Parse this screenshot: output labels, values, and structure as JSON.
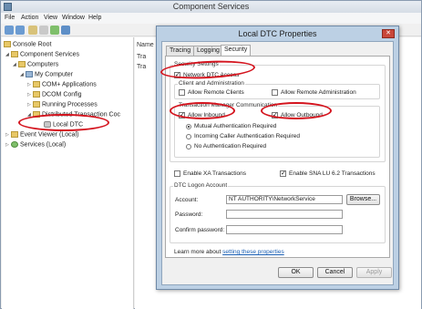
{
  "window": {
    "title": "Component Services"
  },
  "menu": [
    "File",
    "Action",
    "View",
    "Window",
    "Help"
  ],
  "tree": {
    "items": [
      {
        "label": "Console Root"
      },
      {
        "label": "Component Services"
      },
      {
        "label": "Computers"
      },
      {
        "label": "My Computer"
      },
      {
        "label": "COM+ Applications"
      },
      {
        "label": "DCOM Config"
      },
      {
        "label": "Running Processes"
      },
      {
        "label": "Distributed Transaction Coc"
      },
      {
        "label": "Local DTC"
      },
      {
        "label": "Event Viewer (Local)"
      },
      {
        "label": "Services (Local)"
      }
    ]
  },
  "list": {
    "header": "Name",
    "rows": [
      "Tra",
      "Tra"
    ]
  },
  "dialog": {
    "title": "Local DTC Properties",
    "tabs": [
      "Tracing",
      "Logging",
      "Security"
    ],
    "active_tab": "Security",
    "security_settings": {
      "group_label": "Security Settings",
      "network_dtc_access": "Network DTC Access",
      "client_admin": {
        "group_label": "Client and Administration",
        "allow_remote_clients": "Allow Remote Clients",
        "allow_remote_admin": "Allow Remote Administration"
      },
      "tm_comm": {
        "group_label": "Transaction Manager Communication",
        "allow_inbound": "Allow Inbound",
        "allow_outbound": "Allow Outbound",
        "mutual_auth": "Mutual Authentication Required",
        "incoming_caller_auth": "Incoming Caller Authentication Required",
        "no_auth": "No Authentication Required"
      }
    },
    "enable_xa": "Enable XA Transactions",
    "enable_sna": "Enable SNA LU 6.2 Transactions",
    "logon": {
      "group_label": "DTC Logon Account",
      "account_label": "Account:",
      "account_value": "NT AUTHORITY\\NetworkService",
      "browse": "Browse...",
      "password_label": "Password:",
      "confirm_label": "Confirm password:"
    },
    "learn_more_prefix": "Learn more about",
    "learn_more_link": "setting these properties",
    "buttons": {
      "ok": "OK",
      "cancel": "Cancel",
      "apply": "Apply"
    }
  },
  "colors": {
    "annotation": "#d4141e",
    "link": "#1a5fb4"
  }
}
